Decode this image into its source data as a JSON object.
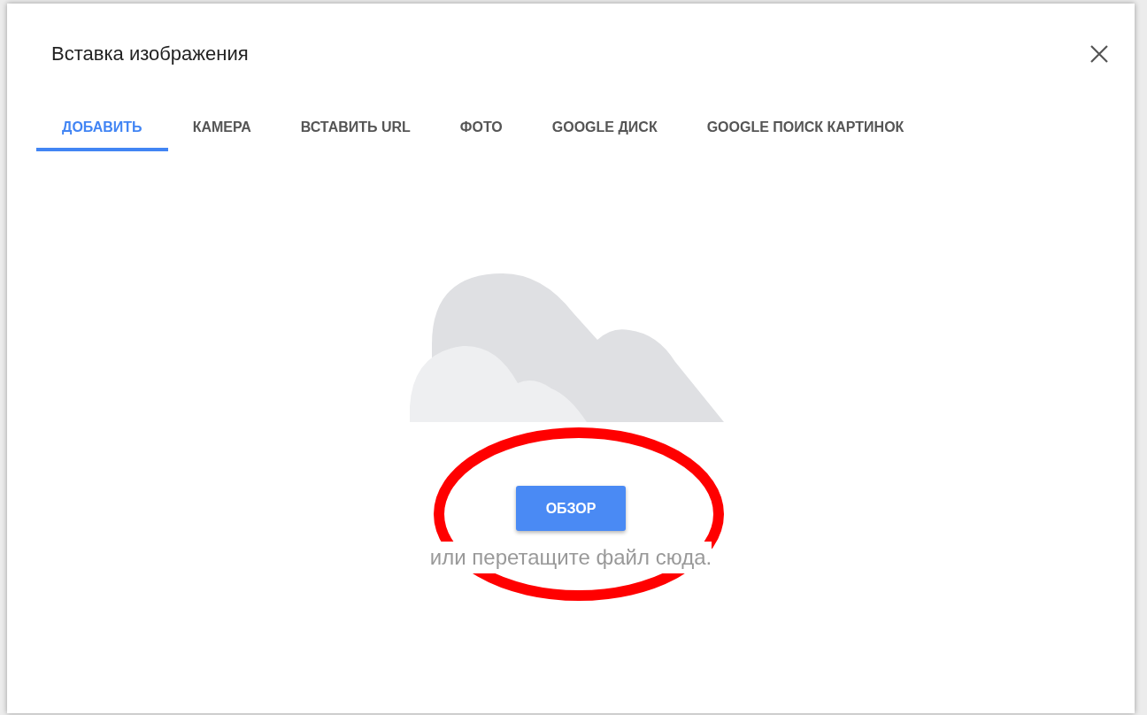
{
  "dialog": {
    "title": "Вставка изображения",
    "tabs": [
      {
        "label": "ДОБАВИТЬ",
        "selected": true
      },
      {
        "label": "КАМЕРА",
        "selected": false
      },
      {
        "label": "ВСТАВИТЬ URL",
        "selected": false
      },
      {
        "label": "ФОТО",
        "selected": false
      },
      {
        "label": "GOOGLE ДИСК",
        "selected": false
      },
      {
        "label": "GOOGLE ПОИСК КАРТИНОК",
        "selected": false
      }
    ],
    "upload": {
      "button": "ОБЗОР",
      "hint": "или перетащите файл сюда."
    }
  }
}
